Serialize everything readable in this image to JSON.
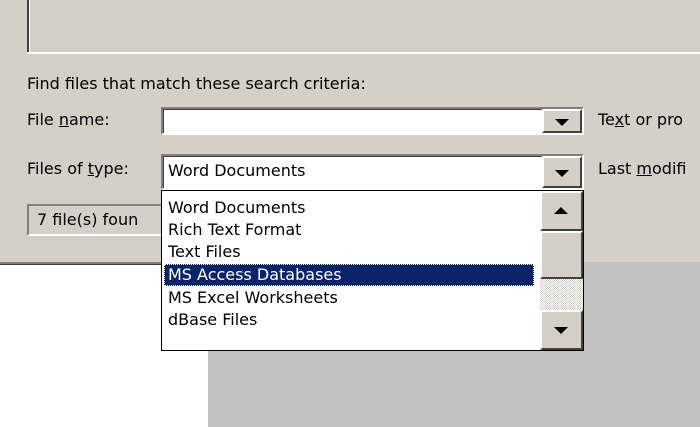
{
  "search": {
    "criteria_label": "Find files that match these search criteria:",
    "file_name_pre": "File ",
    "file_name_u": "n",
    "file_name_post": "ame:",
    "file_name_value": "",
    "text_prop_pre": "Te",
    "text_prop_u": "x",
    "text_prop_post": "t or pro",
    "files_type_pre": "Files of ",
    "files_type_u": "t",
    "files_type_post": "ype:",
    "files_type_value": "Word Documents",
    "last_mod_pre": "Last ",
    "last_mod_u": "m",
    "last_mod_post": "odifi"
  },
  "status": {
    "text": "7 file(s) foun"
  },
  "dropdown": {
    "options": [
      "Word Documents",
      "Rich Text Format",
      "Text Files",
      "MS Access Databases",
      "MS Excel Worksheets",
      "dBase Files"
    ],
    "selected": "MS Access Databases"
  },
  "colors": {
    "face": "#d4d0c8",
    "highlight": "#0a246a"
  }
}
